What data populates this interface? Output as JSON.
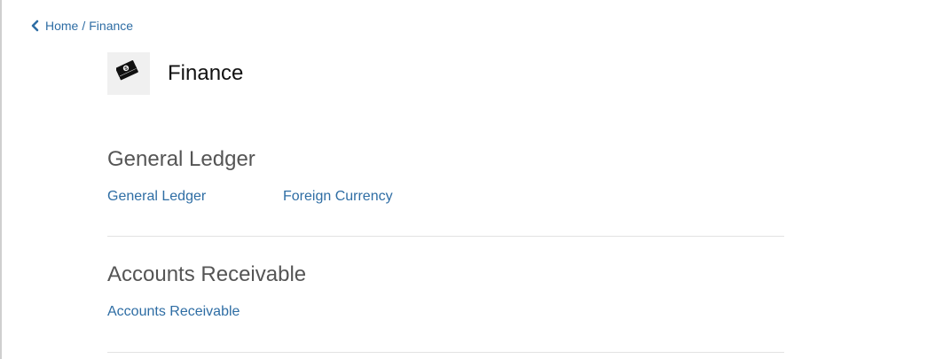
{
  "breadcrumb": {
    "back_icon": "chevron-left-icon",
    "home": "Home",
    "separator": "/",
    "current": "Finance"
  },
  "header": {
    "icon": "money-stack-icon",
    "title": "Finance"
  },
  "sections": [
    {
      "heading": "General Ledger",
      "links": [
        "General Ledger",
        "Foreign Currency"
      ]
    },
    {
      "heading": "Accounts Receivable",
      "links": [
        "Accounts Receivable"
      ]
    }
  ],
  "colors": {
    "link": "#2e6da4",
    "heading": "#555555",
    "title": "#111111",
    "divider": "#e2e2e2",
    "icon_bg": "#f0f0f0"
  }
}
